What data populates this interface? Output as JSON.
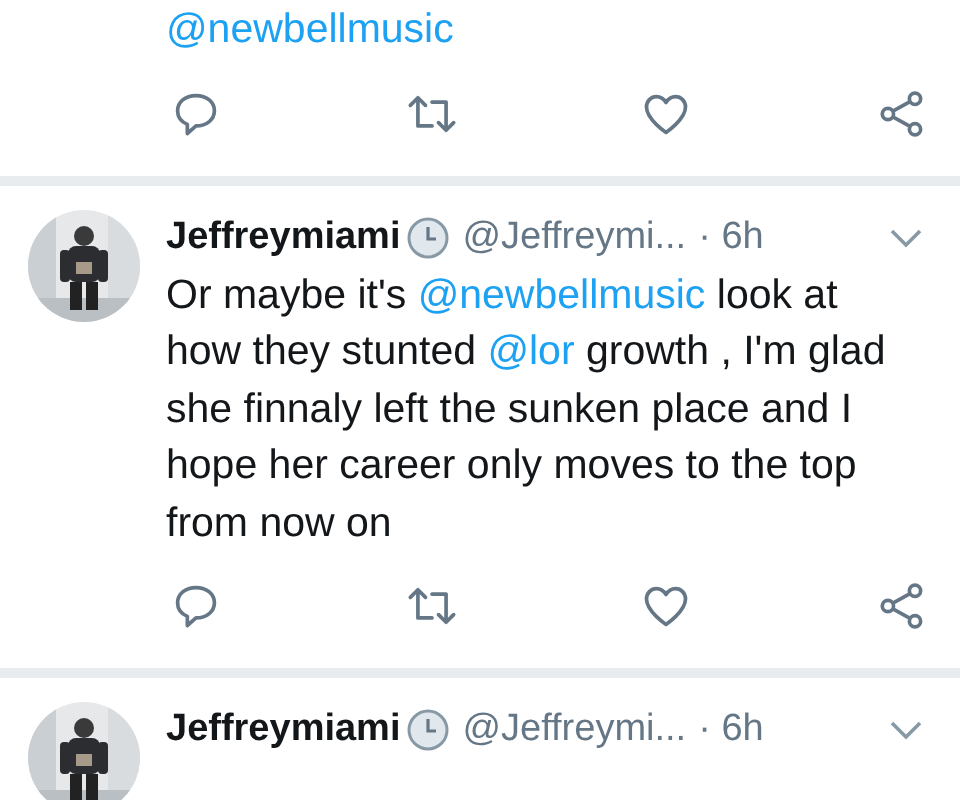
{
  "tweets": [
    {
      "body": [
        {
          "kind": "mention",
          "text": "@newbellmusic"
        }
      ]
    },
    {
      "name": "Jeffreymiami",
      "handle": "@Jeffreymi...",
      "time": "· 6h",
      "body": [
        {
          "kind": "text",
          "text": "Or maybe it's "
        },
        {
          "kind": "mention",
          "text": "@newbellmusic"
        },
        {
          "kind": "text",
          "text": " look at how they stunted "
        },
        {
          "kind": "mention",
          "text": "@lor"
        },
        {
          "kind": "text",
          "text": " growth , I'm glad she finnaly left the sunken place and I hope her career only moves to the top from now on"
        }
      ]
    },
    {
      "name": "Jeffreymiami",
      "handle": "@Jeffreymi...",
      "time": "· 6h"
    }
  ]
}
